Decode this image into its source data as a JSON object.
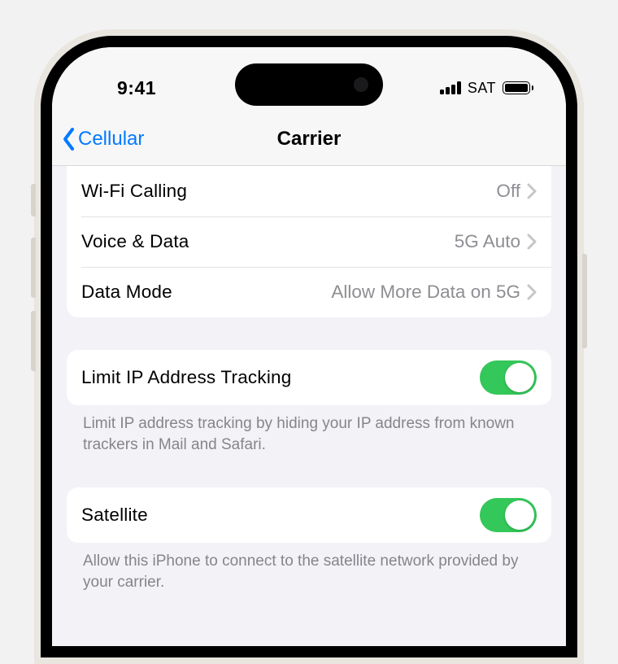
{
  "status": {
    "time": "9:41",
    "network_label": "SAT"
  },
  "nav": {
    "back_label": "Cellular",
    "title": "Carrier"
  },
  "group1": {
    "wifi_calling": {
      "label": "Wi-Fi Calling",
      "value": "Off"
    },
    "voice_data": {
      "label": "Voice & Data",
      "value": "5G Auto"
    },
    "data_mode": {
      "label": "Data Mode",
      "value": "Allow More Data on 5G"
    }
  },
  "limit_ip": {
    "label": "Limit IP Address Tracking",
    "on": true,
    "footer": "Limit IP address tracking by hiding your IP address from known trackers in Mail and Safari."
  },
  "satellite": {
    "label": "Satellite",
    "on": true,
    "footer": "Allow this iPhone to connect to the satellite network provided by your carrier."
  }
}
